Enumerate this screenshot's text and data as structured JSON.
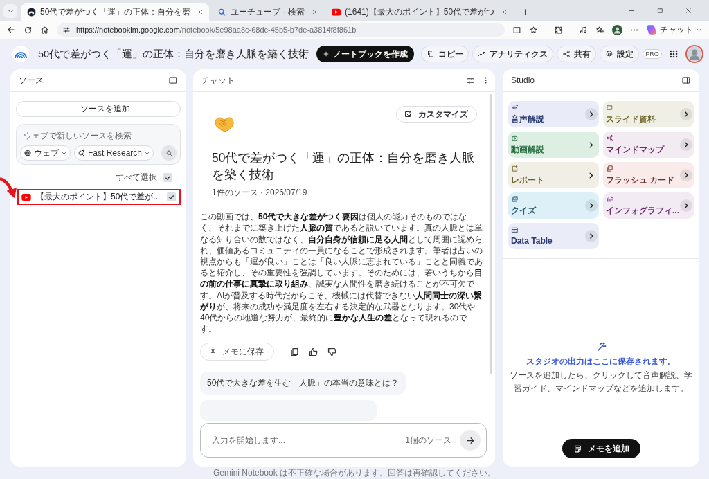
{
  "browser": {
    "tabs": [
      {
        "title": "50代で差がつく「運」の正体：自分を磨",
        "selected": true
      },
      {
        "title": "ユーチューブ - 検索",
        "selected": false
      },
      {
        "title": "(1641)【最大のポイント】50代で差がつ",
        "selected": false
      }
    ],
    "url_host": "https://notebooklm.google.com",
    "url_path": "/notebook/5e98aa8c-68dc-45b5-b7de-a3814f8f861b",
    "copilot_label": "チャット"
  },
  "header": {
    "title": "50代で差がつく「運」の正体：自分を磨き人脈を築く技術",
    "create_button": "ノートブックを作成",
    "actions": [
      "コピー",
      "アナリティクス",
      "共有",
      "設定"
    ],
    "plan_badge": "PRO"
  },
  "sources": {
    "title": "ソース",
    "add_button": "ソースを追加",
    "search": {
      "placeholder": "ウェブで新しいソースを検索",
      "chips": [
        "ウェブ",
        "Fast Research"
      ]
    },
    "select_all": {
      "label": "すべて選択",
      "checked": true
    },
    "items": [
      {
        "title": "【最大のポイント】50代で差が...",
        "checked": true,
        "highlighted": true
      }
    ]
  },
  "chat": {
    "title": "チャット",
    "customize_button": "カスタマイズ",
    "notebook_title": "50代で差がつく「運」の正体：自分を磨き人脈を築く技術",
    "meta": "1件のソース · 2026/07/19",
    "summary": "この動画では、**50代で大きな差がつく要因**は個人の能力そのものではなく、それまでに築き上げた**人脈の質**であると説いています。真の人脈とは単なる知り合いの数ではなく、**自分自身が信頼に足る人間**として周囲に認められ、価値あるコミュニティの一員になることで形成されます。筆者は占いの視点からも「運が良い」ことは「良い人脈に恵まれている」ことと同義であると紹介し、その重要性を強調しています。そのためには、若いうちから**目の前の仕事に真摯に取り組み**、誠実な人間性を磨き続けることが不可欠です。AIが普及する時代だからこそ、機械には代替できない**人間同士の深い繋がり**が、将来の成功や満足度を左右する決定的な武器となります。30代や40代からの地道な努力が、最終的に**豊かな人生の差**となって現れるのです。",
    "save_button": "メモに保存",
    "suggestions": [
      "50代で大きな差を生む「人脈」の本当の意味とは？"
    ],
    "input": {
      "placeholder": "入力を開始します...",
      "source_count": "1個のソース"
    }
  },
  "studio": {
    "title": "Studio",
    "tools": [
      {
        "label": "音声解説",
        "color": "#e9ecf8",
        "arrow_disc": true
      },
      {
        "label": "スライド資料",
        "color": "#f0efe6",
        "arrow_disc": true
      },
      {
        "label": "動画解説",
        "color": "#ddefe3",
        "arrow_disc": false
      },
      {
        "label": "マインドマップ",
        "color": "#f3ebf2",
        "arrow_disc": true
      },
      {
        "label": "レポート",
        "color": "#f1efe5",
        "arrow_disc": false
      },
      {
        "label": "フラッシュ カード",
        "color": "#f8ebea",
        "arrow_disc": true
      },
      {
        "label": "クイズ",
        "color": "#ddf0f7",
        "arrow_disc": true
      },
      {
        "label": "インフォグラフィ...",
        "color": "#f3ebf3",
        "arrow_disc": true
      },
      {
        "label": "Data Table",
        "color": "#eaedf8",
        "arrow_disc": true
      }
    ],
    "empty_state": {
      "heading": "スタジオの出力はここに保存されます。",
      "text": "ソースを追加したら、クリックして音声解説、学習ガイド、マインドマップなどを追加します。"
    },
    "add_note_button": "メモを追加"
  },
  "footer": "Gemini Notebook は不正確な場合があります。回答は再確認してください。"
}
